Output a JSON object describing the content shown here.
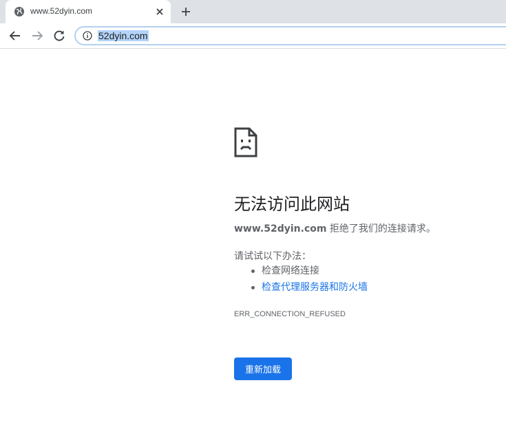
{
  "browser": {
    "tab": {
      "title": "www.52dyin.com",
      "favicon": "globe-icon",
      "close_icon": "close-icon"
    },
    "new_tab_icon": "plus-icon",
    "nav": {
      "back_icon": "arrow-left-icon",
      "forward_icon": "arrow-right-icon",
      "reload_icon": "reload-icon"
    },
    "omnibox": {
      "info_icon": "info-icon",
      "url": "52dyin.com"
    }
  },
  "error_page": {
    "icon": "sad-page-icon",
    "title": "无法访问此网站",
    "host": "www.52dyin.com",
    "description": " 拒绝了我们的连接请求。",
    "suggestions_heading": "请试试以下办法：",
    "suggestions": [
      {
        "label": "检查网络连接",
        "is_link": false
      },
      {
        "label": "检查代理服务器和防火墙",
        "is_link": true
      }
    ],
    "error_code": "ERR_CONNECTION_REFUSED",
    "reload_label": "重新加载"
  },
  "colors": {
    "accent": "#1a73e8",
    "tabstrip": "#dee1e6",
    "text_secondary": "#5f6368"
  }
}
